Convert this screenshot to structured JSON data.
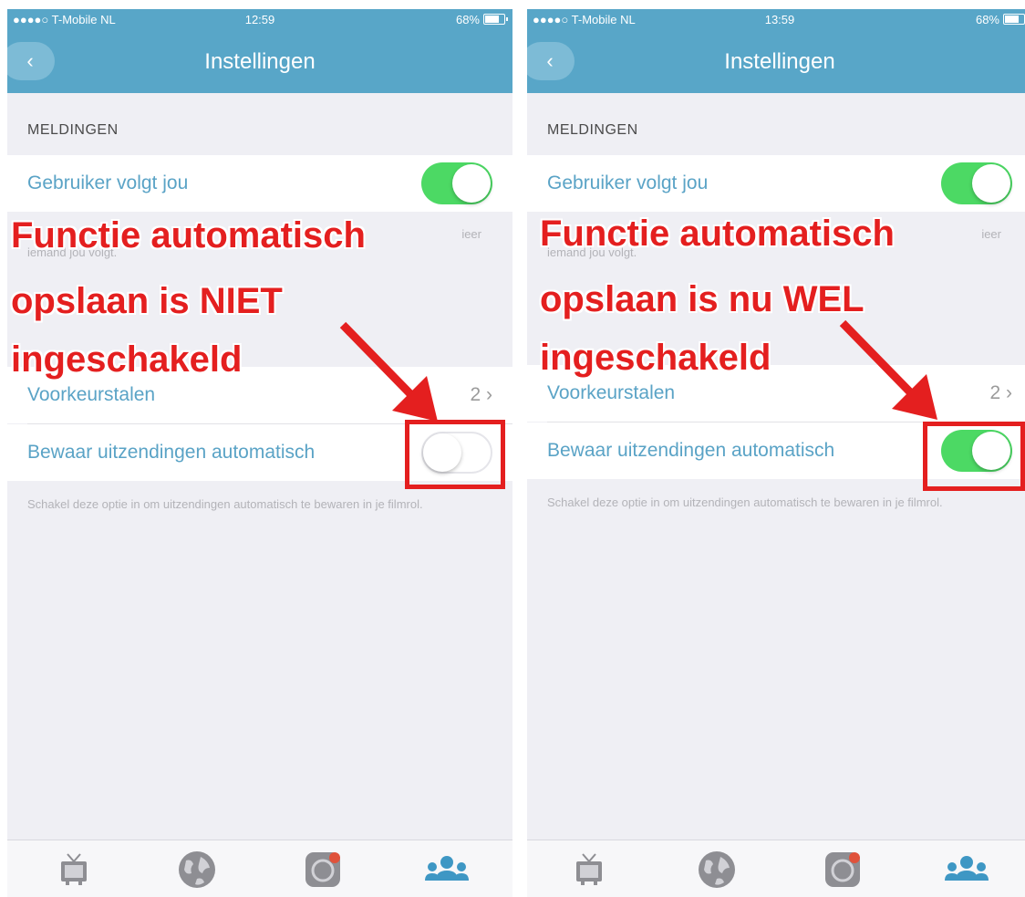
{
  "screens": [
    {
      "status": {
        "carrier": "●●●●○ T-Mobile NL",
        "time": "12:59",
        "battery": "68%"
      },
      "nav": {
        "title": "Instellingen"
      },
      "section_notifications": "MELDINGEN",
      "row_follow": {
        "label": "Gebruiker volgt jou",
        "toggle": "on"
      },
      "hidden_note_fragment": "ieer",
      "hidden_note_line": "iemand jou volgt.",
      "row_languages": {
        "label": "Voorkeurstalen",
        "value": "2"
      },
      "row_autosave": {
        "label": "Bewaar uitzendingen automatisch",
        "toggle": "off"
      },
      "footnote": "Schakel deze optie in om uitzendingen automatisch te bewaren in je filmrol.",
      "annotation": {
        "line1": "Functie automatisch",
        "line2": "opslaan is NIET",
        "line3": "ingeschakeld"
      }
    },
    {
      "status": {
        "carrier": "●●●●○ T-Mobile NL",
        "time": "13:59",
        "battery": "68%"
      },
      "nav": {
        "title": "Instellingen"
      },
      "section_notifications": "MELDINGEN",
      "row_follow": {
        "label": "Gebruiker volgt jou",
        "toggle": "on"
      },
      "hidden_note_fragment": "ieer",
      "hidden_note_line": "iemand jou volgt.",
      "row_languages": {
        "label": "Voorkeurstalen",
        "value": "2"
      },
      "row_autosave": {
        "label": "Bewaar uitzendingen automatisch",
        "toggle": "on"
      },
      "footnote": "Schakel deze optie in om uitzendingen automatisch te bewaren in je filmrol.",
      "annotation": {
        "line1": "Functie automatisch",
        "line2": "opslaan is nu WEL",
        "line3": "ingeschakeld"
      }
    }
  ],
  "tabs": [
    {
      "icon": "tv-icon"
    },
    {
      "icon": "globe-icon"
    },
    {
      "icon": "camera-record-icon"
    },
    {
      "icon": "people-icon"
    }
  ],
  "colors": {
    "header": "#58a6c8",
    "accent_text": "#5aa3c6",
    "toggle_on": "#4cd964",
    "annotation_red": "#e41f1f"
  }
}
